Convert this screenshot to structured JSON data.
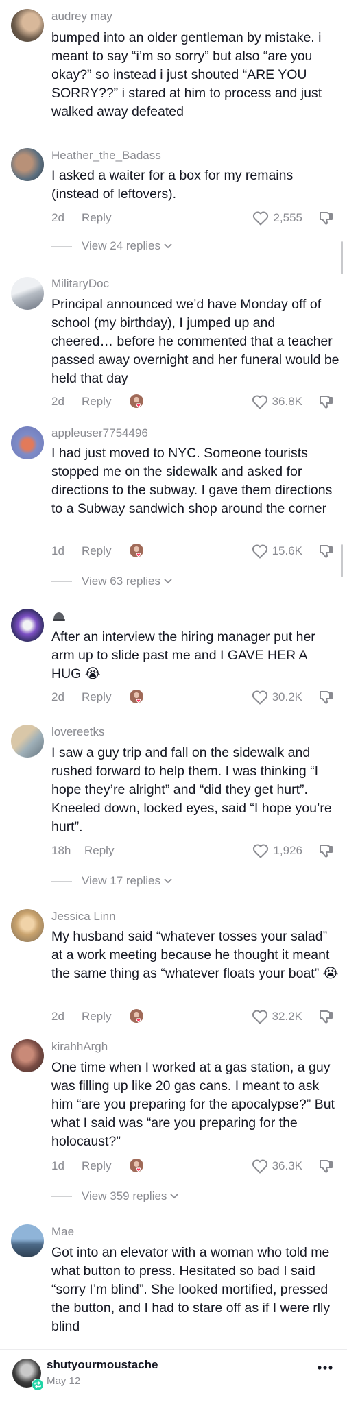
{
  "comments": [
    {
      "username": "audrey may",
      "text": "bumped into an older gentleman by mistake. i meant to say “i’m so sorry” but also “are you okay?” so instead i just shouted “ARE YOU SORRY??” i stared at him to process and just walked away defeated"
    },
    {
      "username": "Heather_the_Badass",
      "text": "I asked a waiter for a box for my remains (instead of leftovers).",
      "date": "2d",
      "reply": "Reply",
      "likes": "2,555",
      "view_replies": "View 24 replies"
    },
    {
      "username": "MilitaryDoc",
      "text": "Principal announced we’d have Monday off of school (my birthday), I jumped up and cheered… before he commented that a teacher passed away overnight and her funeral would be held that day",
      "date": "2d",
      "reply": "Reply",
      "likes": "36.8K"
    },
    {
      "username": "appleuser7754496",
      "text": "I had just moved to NYC. Someone tourists stopped me on the sidewalk and asked for directions to the subway. I gave them directions to a Subway sandwich shop around the corner",
      "date": "1d",
      "reply": "Reply",
      "likes": "15.6K",
      "view_replies": "View 63 replies"
    },
    {
      "username": "",
      "text": "After an interview the hiring manager put her arm up to slide past me and I GAVE HER A HUG 😭",
      "date": "2d",
      "reply": "Reply",
      "likes": "30.2K"
    },
    {
      "username": "lovereetks",
      "text": "I saw a guy trip and fall on the sidewalk and rushed forward to help them. I was thinking “I hope they’re alright” and “did they get hurt”. Kneeled down, locked eyes, said “I hope you’re hurt”.",
      "date": "18h",
      "reply": "Reply",
      "likes": "1,926",
      "view_replies": "View 17 replies"
    },
    {
      "username": "Jessica Linn",
      "text": "My husband said “whatever tosses your salad” at a work meeting because he thought it meant the same thing as “whatever floats your boat” 😭",
      "date": "2d",
      "reply": "Reply",
      "likes": "32.2K"
    },
    {
      "username": "kirahhArgh",
      "text": "One time when I worked at a gas station, a guy was filling up like 20 gas cans. I meant to ask him “are you preparing for the apocalypse?” But what I said was “are you preparing for the holocaust?”",
      "date": "1d",
      "reply": "Reply",
      "likes": "36.3K",
      "view_replies": "View 359 replies"
    },
    {
      "username": "Mae",
      "text": "Got into an elevator with a woman who told me what button to press. Hesitated so bad I said “sorry I’m blind”. She looked mortified, pressed the button, and I had to stare off as if I were rlly blind"
    }
  ],
  "footer": {
    "username": "shutyourmoustache",
    "date": "May 12"
  },
  "icons": {
    "like": "heart-outline-icon",
    "dislike": "thumbs-down-icon",
    "more": "more-dots-icon",
    "creator_liked": "creator-liked-avatar-icon",
    "repost": "repost-badge-icon"
  },
  "colors": {
    "text": "#161823",
    "muted": "#8a8b91",
    "heart_badge": "#fe2c55",
    "repost_badge": "#20d5a7"
  }
}
